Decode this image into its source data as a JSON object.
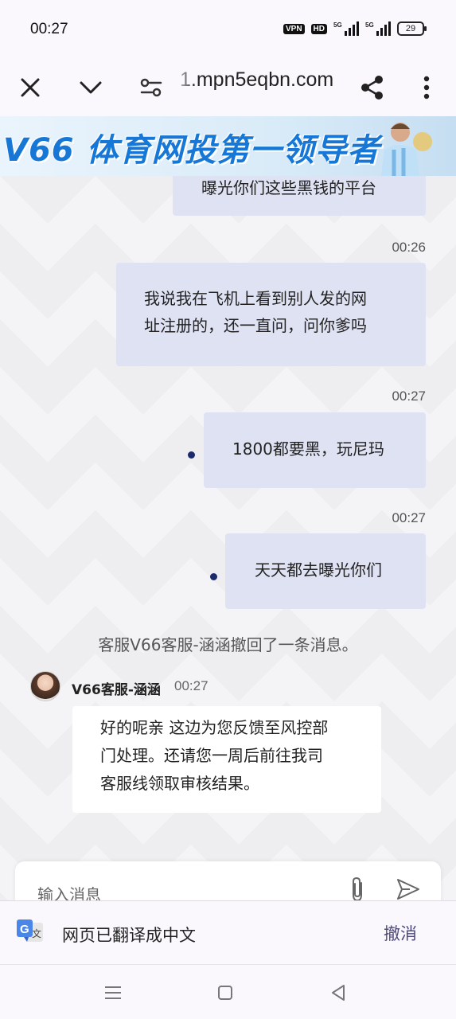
{
  "status_bar": {
    "time": "00:27",
    "vpn": "VPN",
    "hd": "HD",
    "net1": "5G",
    "net2": "5G",
    "battery": "29"
  },
  "toolbar": {
    "url": "1.mpn5eqbn.com"
  },
  "banner": {
    "text": "V66 体育网投第一领导者"
  },
  "chat": {
    "partial_message": "曝光你们这些黑钱的平台",
    "messages": [
      {
        "time": "00:26",
        "lines": [
          "我说我在飞机上看到别人发的网",
          "址注册的，还一直问，问你爹吗"
        ]
      },
      {
        "time": "00:27",
        "lines": [
          "1800都要黑，玩尼玛"
        ]
      },
      {
        "time": "00:27",
        "lines": [
          "天天都去曝光你们"
        ]
      }
    ],
    "recall_notice": "客服V66客服-涵涵撤回了一条消息。",
    "agent": {
      "name": "V66客服-涵涵",
      "time": "00:27",
      "lines": [
        "好的呢亲 这边为您反馈至风控部",
        "门处理。还请您一周后前往我司",
        "客服线领取审核结果。"
      ]
    },
    "input_placeholder": "输入消息"
  },
  "translate_bar": {
    "text": "网页已翻译成中文",
    "undo": "撤消"
  },
  "colors": {
    "outgoing_bubble": "#dfe2f3",
    "banner_text": "#1677d6",
    "undo_text": "#4e4a7c"
  }
}
